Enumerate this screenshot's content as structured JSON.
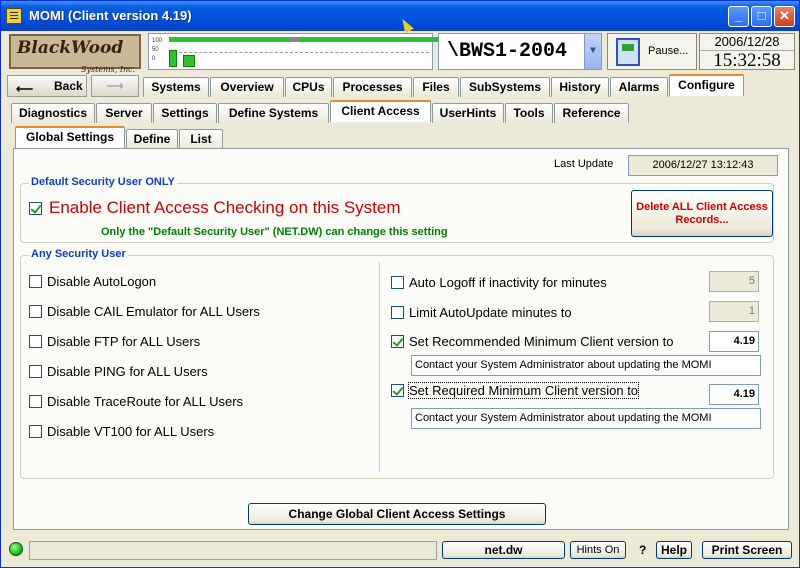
{
  "window": {
    "title": "MOMI (Client version 4.19)",
    "min": "_",
    "max": "□",
    "close": "✕"
  },
  "logo": {
    "text": "BlackWood",
    "sub": "Systems, Inc."
  },
  "graph": {
    "scale": [
      "100",
      "50",
      "0"
    ]
  },
  "server": {
    "name": "\\BWS1-2004",
    "dropdown": "▼"
  },
  "pause": {
    "label": "Pause..."
  },
  "clock": {
    "date": "2006/12/28",
    "time": "15:32:58"
  },
  "nav": {
    "back": "Back",
    "forward": ""
  },
  "main_tabs": [
    "Systems",
    "Overview",
    "CPUs",
    "Processes",
    "Files",
    "SubSystems",
    "History",
    "Alarms",
    "Configure"
  ],
  "config_tabs": [
    "Diagnostics",
    "Server",
    "Settings",
    "Define Systems",
    "Client Access",
    "UserHints",
    "Tools",
    "Reference"
  ],
  "sub_tabs": [
    "Global Settings",
    "Define",
    "List"
  ],
  "last_update": {
    "label": "Last Update",
    "value": "2006/12/27 13:12:43"
  },
  "default_group": {
    "legend": "Default Security User ONLY",
    "enable_label": "Enable Client Access Checking on this System",
    "enable_checked": true,
    "note": "Only the \"Default Security User\" (NET.DW) can change this setting",
    "delete_button": "Delete ALL Client Access Records...",
    "accent": "#cc0000",
    "note_color": "#008000"
  },
  "any_group": {
    "legend": "Any Security User",
    "left": [
      {
        "label": "Disable AutoLogon",
        "checked": false
      },
      {
        "label": "Disable CAIL Emulator for ALL Users",
        "checked": false
      },
      {
        "label": "Disable FTP for ALL Users",
        "checked": false
      },
      {
        "label": "Disable PING for ALL Users",
        "checked": false
      },
      {
        "label": "Disable TraceRoute for ALL Users",
        "checked": false
      },
      {
        "label": "Disable VT100 for ALL Users",
        "checked": false
      }
    ],
    "right": {
      "auto_logoff": {
        "label": "Auto Logoff if inactivity for minutes",
        "checked": false,
        "value": "5"
      },
      "limit_update": {
        "label": "Limit AutoUpdate minutes to",
        "checked": false,
        "value": "1"
      },
      "recommended": {
        "label": "Set Recommended Minimum Client version to",
        "checked": true,
        "value": "4.19",
        "message": "Contact your System Administrator about updating the MOMI"
      },
      "required": {
        "label": "Set Required Minimum Client version to",
        "checked": true,
        "value": "4.19",
        "message": "Contact your System Administrator about updating the MOMI"
      }
    }
  },
  "change_button": "Change Global Client Access Settings",
  "status": {
    "user": "net.dw",
    "hints": "Hints On",
    "q": "?",
    "help": "Help",
    "print": "Print Screen"
  }
}
